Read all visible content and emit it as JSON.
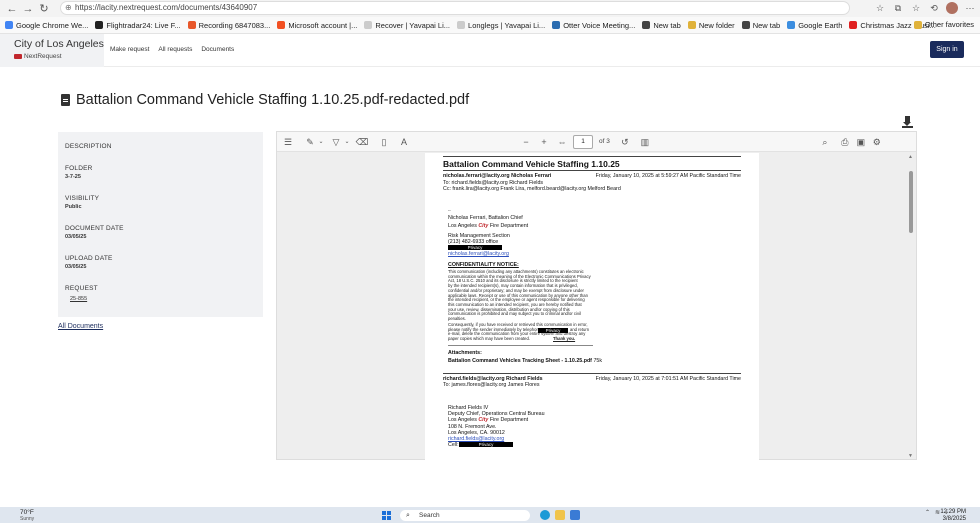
{
  "browser": {
    "url": "https://lacity.nextrequest.com/documents/43640907",
    "bookmarks": [
      {
        "label": "Google Chrome We...",
        "color": "#4285f4"
      },
      {
        "label": "Flightradar24: Live F...",
        "color": "#222222"
      },
      {
        "label": "Recording 6847083...",
        "color": "#e8572a"
      },
      {
        "label": "Microsoft account |...",
        "color": "#f25022"
      },
      {
        "label": "Recover | Yavapai Li...",
        "color": "#cccccc"
      },
      {
        "label": "Longlegs | Yavapai Li...",
        "color": "#cccccc"
      },
      {
        "label": "Otter Voice Meeting...",
        "color": "#2b6cb0"
      },
      {
        "label": "New tab",
        "color": "#444444"
      },
      {
        "label": "New folder",
        "color": "#e0b23a"
      },
      {
        "label": "New tab",
        "color": "#444444"
      },
      {
        "label": "Google Earth",
        "color": "#3c8ee0"
      },
      {
        "label": "Christmas Jazz Musi...",
        "color": "#e02020"
      }
    ],
    "other_favorites": "Other favorites"
  },
  "header": {
    "brand_title": "City of Los Angeles",
    "brand_sub": "NextRequest",
    "nav": [
      "Make request",
      "All requests",
      "Documents"
    ],
    "signin": "Sign in"
  },
  "document": {
    "title": "Battalion Command Vehicle Staffing 1.10.25.pdf-redacted.pdf"
  },
  "sidebar": {
    "description_label": "DESCRIPTION",
    "folder_label": "FOLDER",
    "folder_value": "3-7-25",
    "visibility_label": "VISIBILITY",
    "visibility_value": "Public",
    "doc_date_label": "DOCUMENT DATE",
    "doc_date_value": "03/05/25",
    "upload_date_label": "UPLOAD DATE",
    "upload_date_value": "03/05/25",
    "request_label": "REQUEST",
    "request_value": "25-855",
    "all_documents": "All Documents"
  },
  "viewer": {
    "page_current": "1",
    "page_total": "of 3"
  },
  "pdf": {
    "title": "Battalion Command Vehicle Staffing 1.10.25",
    "email1": {
      "from": "nicholas.ferrari@lacity.org Nicholas Ferrari",
      "date": "Friday, January 10, 2025 at 5:59:27 AM Pacific Standard Time",
      "to": "To: richard.fields@lacity.org Richard Fields",
      "cc": "Cc: frank.lira@lacity.org Frank Lira, melford.beard@lacity.org Melford Beard"
    },
    "sig1": {
      "dash": "--",
      "name": "Nicholas Ferrari, Battalion Chief",
      "dept_pre": "Los Angeles",
      "dept_city": "City",
      "dept_post": "Fire Department",
      "section": "Risk Management Section",
      "phone": "(213) 482-6933 office",
      "redact": "Privacy",
      "email": "nicholas.ferrari@lacity.org"
    },
    "notice_title": "CONFIDENTIALITY NOTICE:",
    "notice_lines": [
      "This communication (including any attachments) constitutes an electronic",
      "communication within the meaning of the Electronic Communications Privacy",
      "Act, 18 U.S.C. 2510 and its disclosure is strictly limited to the recipient",
      "by the intended recipient(s), may contain information that is privileged,",
      "confidential and/or proprietary; and may be exempt from disclosure under",
      "applicable laws. Receipt or use of this communication by anyone other than",
      "the intended recipient, or the employee or agent responsible for delivering",
      "this communication to an intended recipient, you are hereby notified that",
      "your use, review, dissemination, distribution and/or copying of this",
      "communication is prohibited and may subject you to criminal and/or civil",
      "penalties."
    ],
    "notice2_lines": [
      "Consequently, if you have received or retrieved this communication in error,",
      "please notify the sender immediately by telephone",
      "e-mail, delete the communication from your entire system and destroy any",
      "paper copies which may have been created."
    ],
    "notice2_redact": "Privacy",
    "notice2_tail": "and return",
    "thank_you": "Thank you.",
    "attachments_label": "Attachments:",
    "attachment": "Battalion Command Vehicles Tracking Sheet - 1.10.25.pdf",
    "attachment_size": "75k",
    "email2": {
      "from": "richard.fields@lacity.org Richard Fields",
      "date": "Friday, January 10, 2025 at 7:01:51 AM Pacific Standard Time",
      "to": "To: james.flores@lacity.org James Flores"
    },
    "sig2": {
      "name": "Richard Fields IV",
      "title": "Deputy Chief, Operations Central Bureau",
      "dept_pre": "Los Angeles",
      "dept_city": "City",
      "dept_post": "Fire Department",
      "addr1": "108 N. Fremont Ave.",
      "addr2": "Los Angeles, CA. 90012",
      "email": "richard.fields@lacity.org",
      "cell": "Cell:",
      "redact": "Privacy"
    }
  },
  "taskbar": {
    "temp": "70°F",
    "weather": "Sunny",
    "search": "Search",
    "time": "12:29 PM",
    "date": "3/8/2025"
  }
}
